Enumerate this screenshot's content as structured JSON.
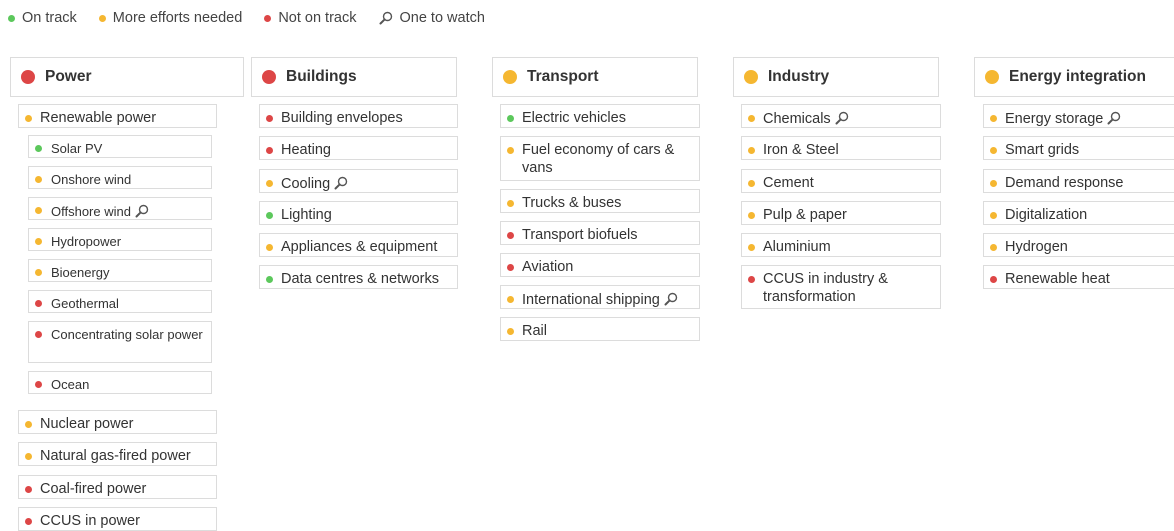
{
  "colors": {
    "green": "#5cc85c",
    "amber": "#f5b731",
    "red": "#dd4646"
  },
  "legend": [
    {
      "label": "On track",
      "status": "green",
      "icon": null
    },
    {
      "label": "More efforts needed",
      "status": "amber",
      "icon": null
    },
    {
      "label": "Not on track",
      "status": "red",
      "icon": null
    },
    {
      "label": "One to watch",
      "status": null,
      "icon": "magnifier-icon"
    }
  ],
  "columns": [
    {
      "title": "Power",
      "status": "red",
      "items": [
        {
          "label": "Renewable power",
          "status": "amber",
          "watch": false
        },
        {
          "label": "Solar PV",
          "status": "green",
          "watch": false
        },
        {
          "label": "Onshore wind",
          "status": "amber",
          "watch": false
        },
        {
          "label": "Offshore wind",
          "status": "amber",
          "watch": true
        },
        {
          "label": "Hydropower",
          "status": "amber",
          "watch": false
        },
        {
          "label": "Bioenergy",
          "status": "amber",
          "watch": false
        },
        {
          "label": "Geothermal",
          "status": "red",
          "watch": false
        },
        {
          "label": "Concentrating solar power",
          "status": "red",
          "watch": false
        },
        {
          "label": "Ocean",
          "status": "red",
          "watch": false
        },
        {
          "label": "Nuclear power",
          "status": "amber",
          "watch": false
        },
        {
          "label": "Natural gas-fired power",
          "status": "amber",
          "watch": false
        },
        {
          "label": "Coal-fired power",
          "status": "red",
          "watch": false
        },
        {
          "label": "CCUS in power",
          "status": "red",
          "watch": false
        }
      ]
    },
    {
      "title": "Buildings",
      "status": "red",
      "items": [
        {
          "label": "Building envelopes",
          "status": "red",
          "watch": false
        },
        {
          "label": "Heating",
          "status": "red",
          "watch": false
        },
        {
          "label": "Cooling",
          "status": "amber",
          "watch": true
        },
        {
          "label": "Lighting",
          "status": "green",
          "watch": false
        },
        {
          "label": "Appliances & equipment",
          "status": "amber",
          "watch": false
        },
        {
          "label": "Data centres & networks",
          "status": "green",
          "watch": false
        }
      ]
    },
    {
      "title": "Transport",
      "status": "amber",
      "items": [
        {
          "label": "Electric vehicles",
          "status": "green",
          "watch": false
        },
        {
          "label": "Fuel economy of cars & vans",
          "status": "amber",
          "watch": false
        },
        {
          "label": "Trucks & buses",
          "status": "amber",
          "watch": false
        },
        {
          "label": "Transport biofuels",
          "status": "red",
          "watch": false
        },
        {
          "label": "Aviation",
          "status": "red",
          "watch": false
        },
        {
          "label": "International shipping",
          "status": "amber",
          "watch": true
        },
        {
          "label": "Rail",
          "status": "amber",
          "watch": false
        }
      ]
    },
    {
      "title": "Industry",
      "status": "amber",
      "items": [
        {
          "label": "Chemicals",
          "status": "amber",
          "watch": true
        },
        {
          "label": "Iron & Steel",
          "status": "amber",
          "watch": false
        },
        {
          "label": "Cement",
          "status": "amber",
          "watch": false
        },
        {
          "label": "Pulp & paper",
          "status": "amber",
          "watch": false
        },
        {
          "label": "Aluminium",
          "status": "amber",
          "watch": false
        },
        {
          "label": "CCUS in industry & transformation",
          "status": "red",
          "watch": false
        }
      ]
    },
    {
      "title": "Energy integration",
      "status": "amber",
      "items": [
        {
          "label": "Energy storage",
          "status": "amber",
          "watch": true
        },
        {
          "label": "Smart grids",
          "status": "amber",
          "watch": false
        },
        {
          "label": "Demand response",
          "status": "amber",
          "watch": false
        },
        {
          "label": "Digitalization",
          "status": "amber",
          "watch": false
        },
        {
          "label": "Hydrogen",
          "status": "amber",
          "watch": false
        },
        {
          "label": "Renewable heat",
          "status": "red",
          "watch": false
        }
      ]
    }
  ]
}
